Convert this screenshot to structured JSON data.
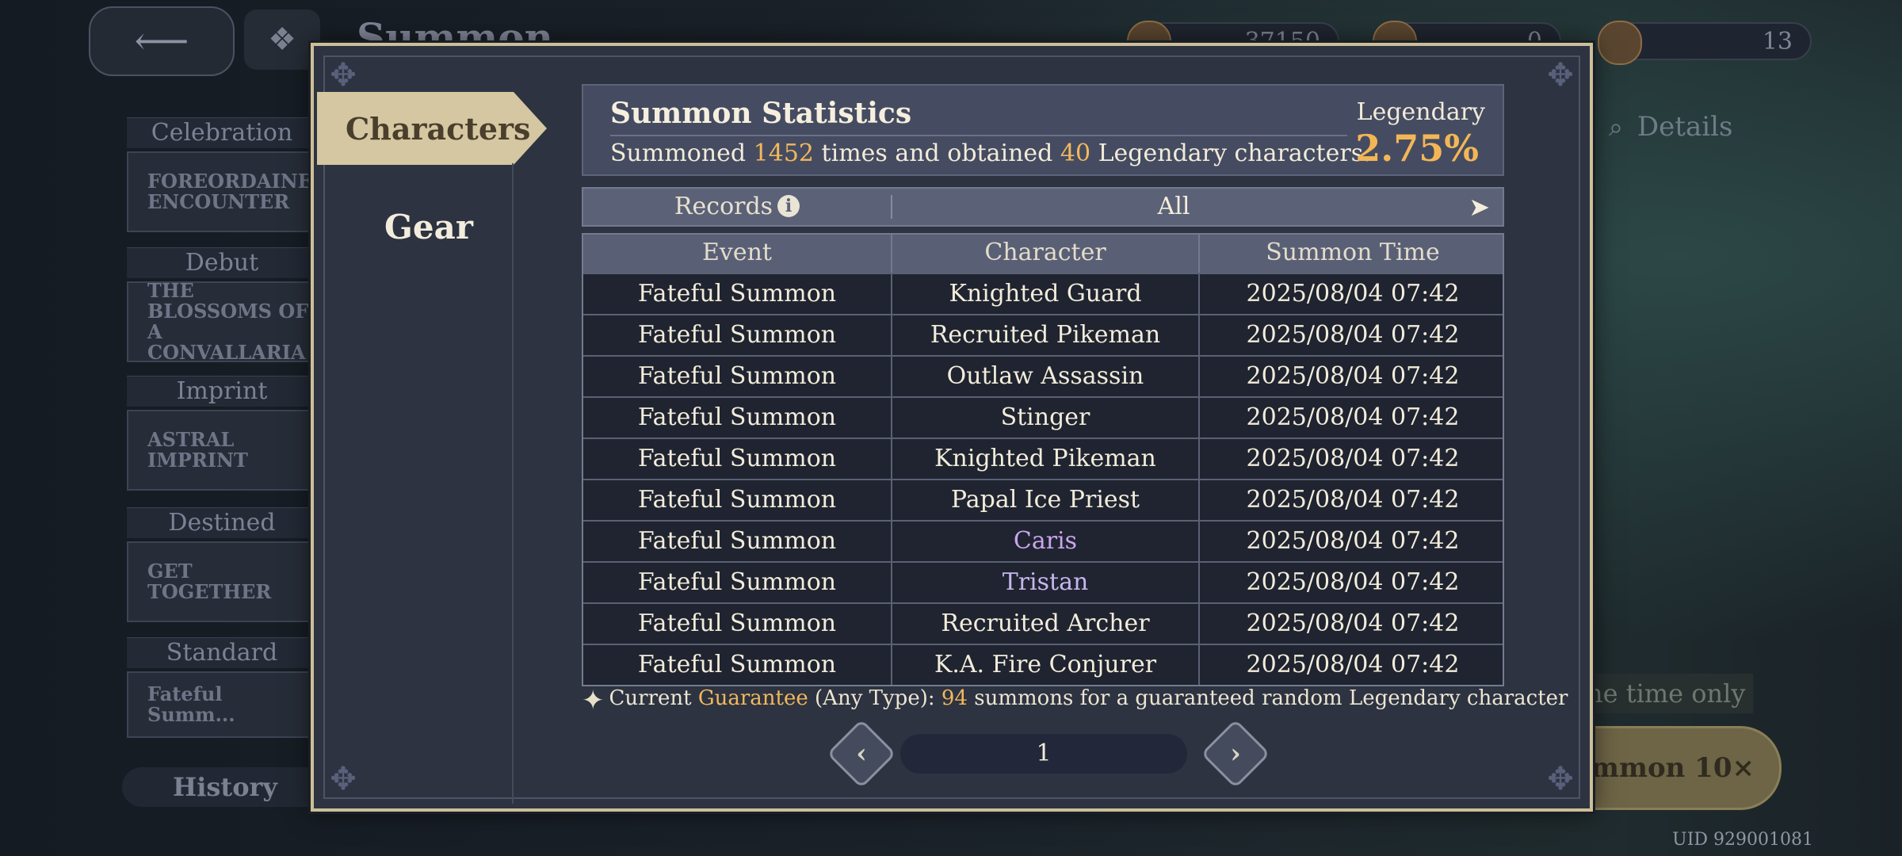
{
  "background": {
    "title": "Summon",
    "currencies": [
      "37150",
      "0",
      "13"
    ],
    "side_categories": [
      "Celebration",
      "Debut",
      "Imprint",
      "Destined",
      "Standard"
    ],
    "side_banners": [
      "FOREORDAINED ENCOUNTER",
      "THE BLOSSOMS OF A CONVALLARIA",
      "ASTRAL IMPRINT",
      "GET TOGETHER",
      "Fateful Summ..."
    ],
    "history_label": "History",
    "details_label": "Details",
    "onetime_label": "ne time only",
    "summon10_label": "mmon 10×",
    "uid": "UID 929001081"
  },
  "sidebar": {
    "tabs": [
      {
        "label": "Characters",
        "active": true
      },
      {
        "label": "Gear",
        "active": false
      }
    ]
  },
  "stats": {
    "title": "Summon Statistics",
    "text_prefix": "Summoned ",
    "summon_count": "1452",
    "text_middle": " times and obtained ",
    "legendary_count": "40",
    "text_suffix": " Legendary characters.",
    "legendary_label": "Legendary",
    "legendary_rate": "2.75%"
  },
  "records": {
    "label": "Records",
    "filter_value": "All"
  },
  "table": {
    "columns": [
      "Event",
      "Character",
      "Summon Time"
    ],
    "rows": [
      {
        "event": "Fateful Summon",
        "character": "Knighted Guard",
        "time": "2025/08/04 07:42"
      },
      {
        "event": "Fateful Summon",
        "character": "Recruited Pikeman",
        "time": "2025/08/04 07:42"
      },
      {
        "event": "Fateful Summon",
        "character": "Outlaw Assassin",
        "time": "2025/08/04 07:42"
      },
      {
        "event": "Fateful Summon",
        "character": "Stinger",
        "time": "2025/08/04 07:42"
      },
      {
        "event": "Fateful Summon",
        "character": "Knighted Pikeman",
        "time": "2025/08/04 07:42"
      },
      {
        "event": "Fateful Summon",
        "character": "Papal Ice Priest",
        "time": "2025/08/04 07:42"
      },
      {
        "event": "Fateful Summon",
        "character": "Caris",
        "time": "2025/08/04 07:42",
        "rarity_color": "#caa6ec"
      },
      {
        "event": "Fateful Summon",
        "character": "Tristan",
        "time": "2025/08/04 07:42",
        "rarity_color": "#c6b6f0"
      },
      {
        "event": "Fateful Summon",
        "character": "Recruited Archer",
        "time": "2025/08/04 07:42"
      },
      {
        "event": "Fateful Summon",
        "character": "K.A. Fire Conjurer",
        "time": "2025/08/04 07:42"
      }
    ]
  },
  "guarantee": {
    "prefix": "Current ",
    "keyword": "Guarantee",
    "middle": " (Any Type): ",
    "count": "94",
    "suffix": " summons for a guaranteed random Legendary character"
  },
  "pager": {
    "page": "1"
  },
  "colors": {
    "accent_gold": "#f2b85c",
    "active_tab": "#d4c7a1",
    "modal_bg": "#2d3341"
  },
  "icons": [
    "back-arrow-icon",
    "home-icon",
    "info-icon",
    "chevron-right-icon",
    "sparkle-icon",
    "chevron-left-icon",
    "magnifier-icon"
  ]
}
